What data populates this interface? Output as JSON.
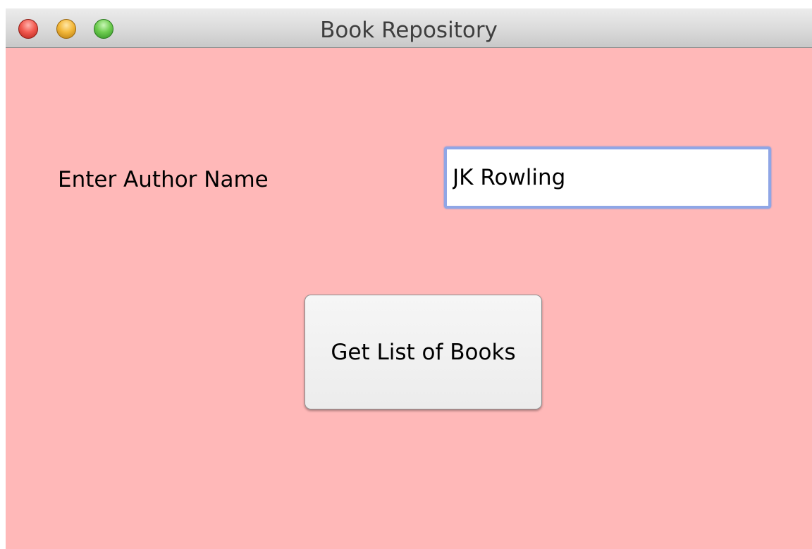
{
  "window": {
    "title": "Book Repository",
    "background_color": "#ffb8b8"
  },
  "form": {
    "author_label": "Enter Author Name",
    "author_value": "JK Rowling",
    "submit_label": "Get List of Books"
  },
  "colors": {
    "close": "#f25a50",
    "minimize": "#f3b83a",
    "zoom": "#6fcd50",
    "input_focus_ring": "#8fa6e6"
  }
}
